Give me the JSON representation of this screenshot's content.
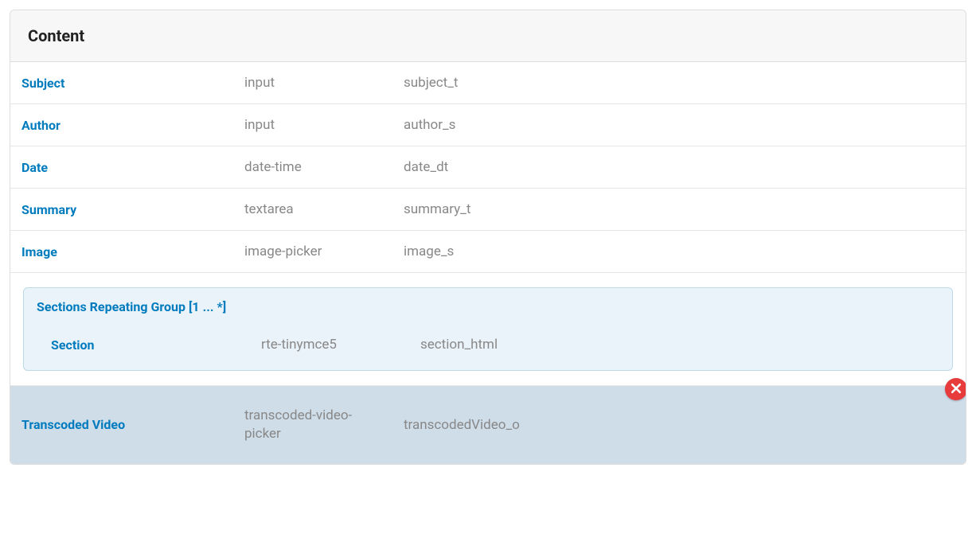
{
  "panel": {
    "title": "Content"
  },
  "fields": [
    {
      "label": "Subject",
      "type": "input",
      "name": "subject_t"
    },
    {
      "label": "Author",
      "type": "input",
      "name": "author_s"
    },
    {
      "label": "Date",
      "type": "date-time",
      "name": "date_dt"
    },
    {
      "label": "Summary",
      "type": "textarea",
      "name": "summary_t"
    },
    {
      "label": "Image",
      "type": "image-picker",
      "name": "image_s"
    }
  ],
  "group": {
    "title": "Sections Repeating Group [1 ... *]",
    "fields": [
      {
        "label": "Section",
        "type": "rte-tinymce5",
        "name": "section_html"
      }
    ]
  },
  "selected": {
    "label": "Transcoded Video",
    "type": "transcoded-video-picker",
    "name": "transcodedVideo_o"
  }
}
